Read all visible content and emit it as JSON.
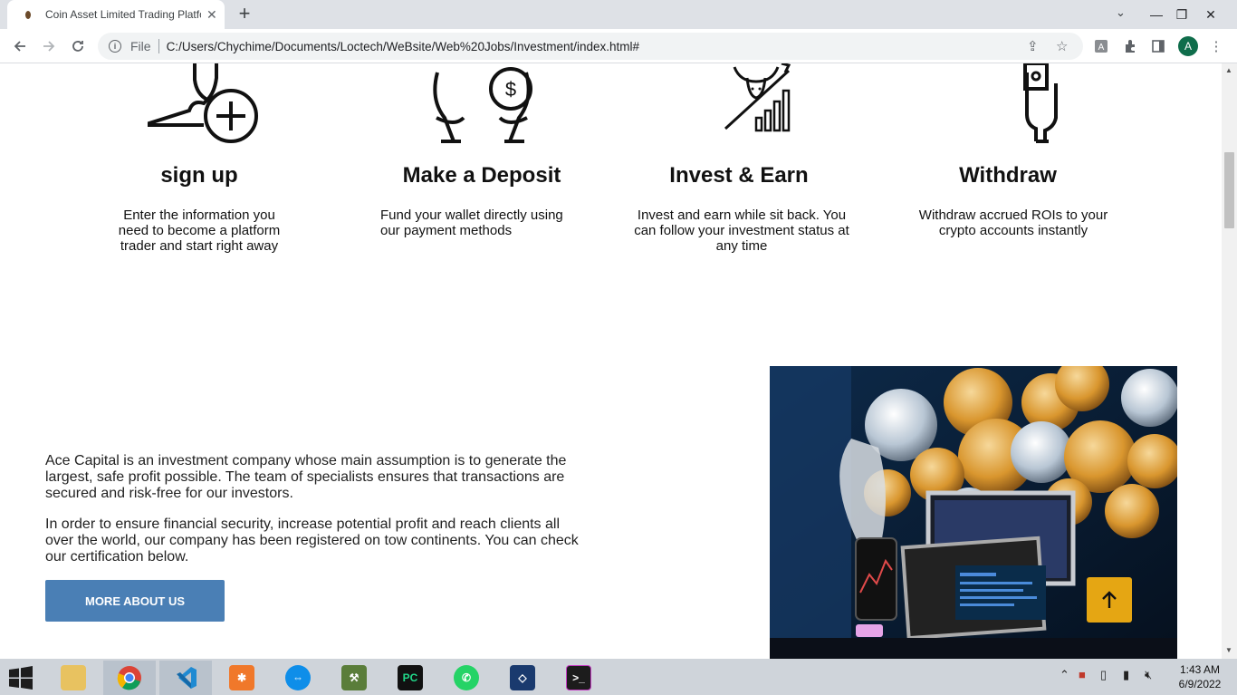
{
  "browser": {
    "tab_title": "Coin Asset Limited Trading Platfo",
    "scheme_label": "File",
    "url": "C:/Users/Chychime/Documents/Loctech/WeBsite/Web%20Jobs/Investment/index.html#",
    "profile_initial": "A"
  },
  "steps": [
    {
      "title": "sign up",
      "description": "Enter the information you need to become a platform trader and start right away"
    },
    {
      "title": "Make a Deposit",
      "description": "Fund your wallet directly using our payment methods"
    },
    {
      "title": "Invest & Earn",
      "description": "Invest and earn while sit back. You can follow your investment status at any time"
    },
    {
      "title": "Withdraw",
      "description": "Withdraw accrued ROIs to your crypto accounts instantly"
    }
  ],
  "about": {
    "paragraph_1": "Ace Capital is an investment company whose main assumption is to generate the largest, safe profit possible. The team of specialists ensures that transactions are secured and risk-free for our investors.",
    "paragraph_2": "In order to ensure financial security, increase potential profit and reach clients all over the world, our company has been registered on tow continents. You can check our certification below.",
    "button_label": "MORE ABOUT US"
  },
  "taskbar": {
    "time": "1:43 AM",
    "date": "6/9/2022"
  },
  "colors": {
    "accent_button": "#4a7fb5",
    "to_top_button": "#e5a613"
  }
}
